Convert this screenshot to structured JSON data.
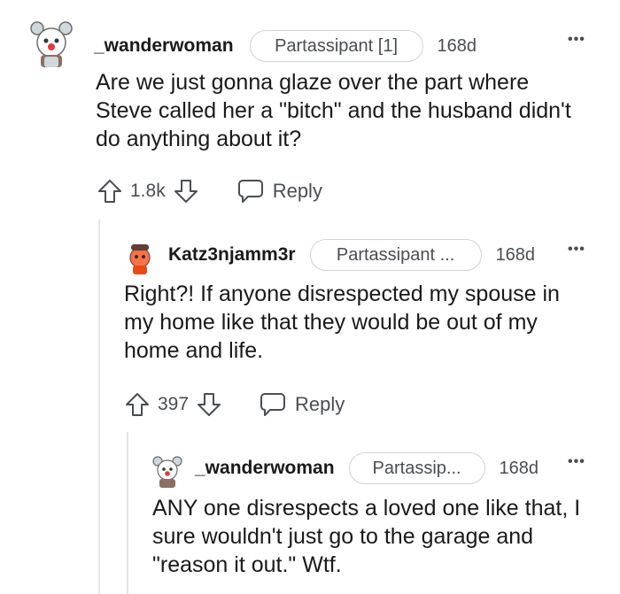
{
  "comments": [
    {
      "username": "_wanderwoman",
      "flair": "Partassipant [1]",
      "age": "168d",
      "more": "•••",
      "body": "Are we just gonna glaze over the part where Steve called her a \"bitch\" and the husband didn't do anything about it?",
      "votes": "1.8k",
      "reply_label": "Reply",
      "avatar_icon": "snoo-avatar-icon"
    },
    {
      "username": "Katz3njamm3r",
      "flair": "Partassipant ...",
      "age": "168d",
      "more": "•••",
      "body": "Right?! If anyone disrespected my spouse in my home like that they would be out of my home and life.",
      "votes": "397",
      "reply_label": "Reply",
      "avatar_icon": "snoo-avatar-icon"
    },
    {
      "username": "_wanderwoman",
      "flair": "Partassip...",
      "age": "168d",
      "more": "•••",
      "body": "ANY one disrespects a loved one like that, I sure wouldn't just go to the garage and \"reason it out.\" Wtf.",
      "avatar_icon": "snoo-avatar-icon"
    }
  ],
  "colors": {
    "text": "#1a1a1b",
    "muted": "#4a4e52",
    "flair_border": "#cfd4d8",
    "thread_line": "#e3e6e8"
  }
}
